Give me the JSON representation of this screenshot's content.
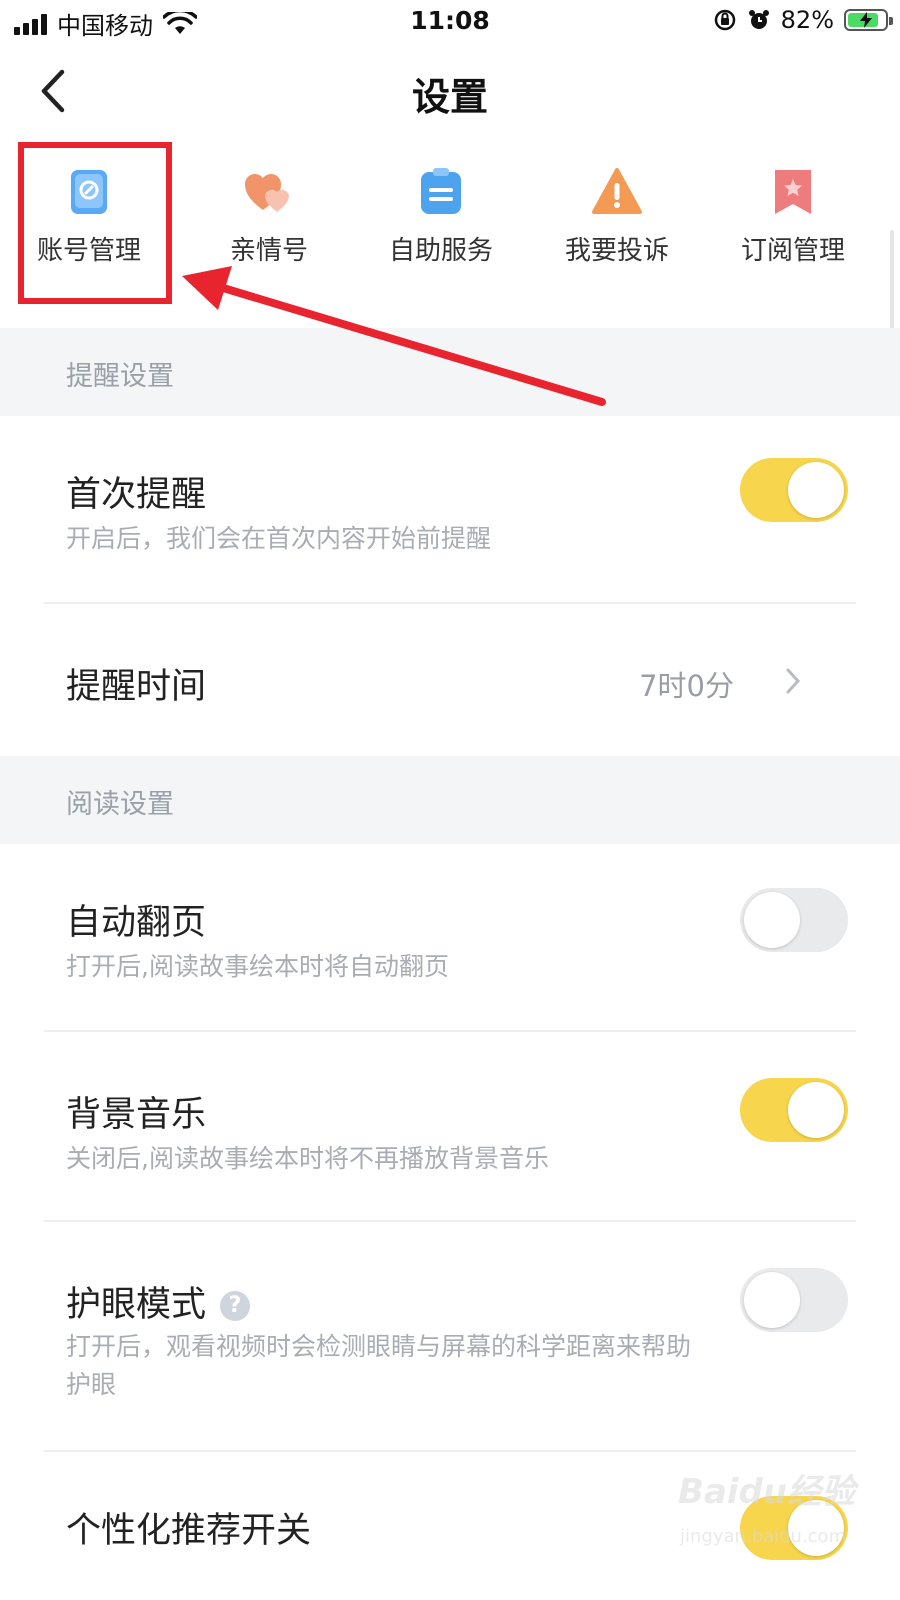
{
  "status_bar": {
    "carrier": "中国移动",
    "time": "11:08",
    "battery_percent": "82%",
    "battery_level": 0.82
  },
  "nav": {
    "title": "设置"
  },
  "quick_menu": [
    {
      "label": "账号管理",
      "icon": "account-card-icon",
      "color": "#5aa9f5"
    },
    {
      "label": "亲情号",
      "icon": "hearts-icon",
      "color": "#f2946a"
    },
    {
      "label": "自助服务",
      "icon": "clipboard-icon",
      "color": "#4da3ee"
    },
    {
      "label": "我要投诉",
      "icon": "warning-icon",
      "color": "#f39a55"
    },
    {
      "label": "订阅管理",
      "icon": "bookmark-star-icon",
      "color": "#ef7c7c"
    }
  ],
  "sections": {
    "reminder": {
      "header": "提醒设置",
      "first_reminder": {
        "title": "首次提醒",
        "desc": "开启后，我们会在首次内容开始前提醒",
        "enabled": true
      },
      "reminder_time": {
        "title": "提醒时间",
        "value": "7时0分"
      }
    },
    "reading": {
      "header": "阅读设置",
      "auto_page": {
        "title": "自动翻页",
        "desc": "打开后,阅读故事绘本时将自动翻页",
        "enabled": false
      },
      "bg_music": {
        "title": "背景音乐",
        "desc": "关闭后,阅读故事绘本时将不再播放背景音乐",
        "enabled": true
      },
      "eye_care": {
        "title": "护眼模式",
        "help": "?",
        "desc": "打开后，观看视频时会检测眼睛与屏幕的科学距离来帮助护眼",
        "enabled": false
      },
      "personalized": {
        "title": "个性化推荐开关",
        "enabled": true
      }
    }
  },
  "watermark": {
    "logo": "Baidu经验",
    "url": "jingyan.baidu.com"
  },
  "colors": {
    "toggle_on": "#f7d54d",
    "toggle_off": "#e9eaec",
    "annotation_red": "#e8242f"
  }
}
